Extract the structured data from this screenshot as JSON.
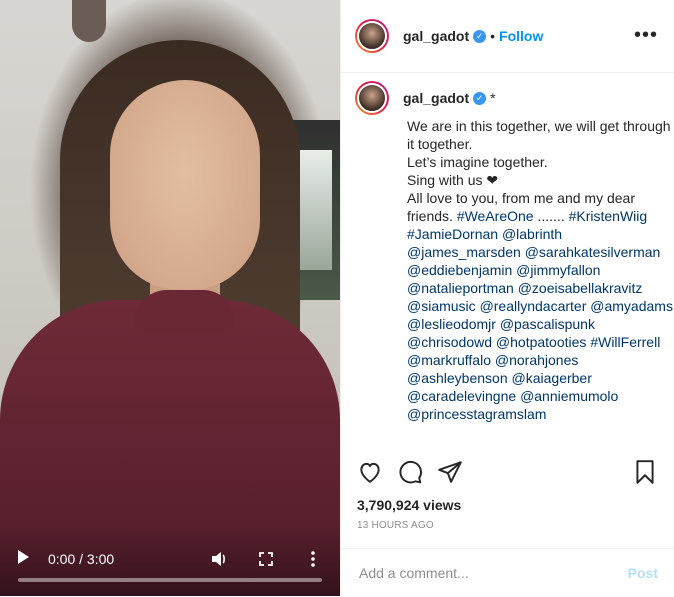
{
  "video": {
    "time_display": "0:00 / 3:00",
    "progress": 0.0,
    "controls": [
      "play-icon",
      "volume-icon",
      "fullscreen-icon",
      "more-vertical-icon"
    ]
  },
  "header": {
    "username": "gal_gadot",
    "separator": "•",
    "follow_label": "Follow",
    "more_label": "•••"
  },
  "caption": {
    "username": "gal_gadot",
    "star": "*",
    "text_parts": [
      {
        "t": "We are in this together, we will get through it together.\nLet’s imagine together.\nSing with us ❤\nAll love to you, from me and my dear friends. "
      },
      {
        "t": "#WeAreOne",
        "tag": true
      },
      {
        "t": " ....... "
      },
      {
        "t": "#KristenWiig",
        "tag": true
      },
      {
        "t": " "
      },
      {
        "t": "#JamieDornan",
        "tag": true
      },
      {
        "t": " "
      },
      {
        "t": "@labrinth",
        "tag": true
      },
      {
        "t": " "
      },
      {
        "t": "@james_marsden",
        "tag": true
      },
      {
        "t": " "
      },
      {
        "t": "@sarahkatesilverman",
        "tag": true
      },
      {
        "t": " "
      },
      {
        "t": "@eddiebenjamin",
        "tag": true
      },
      {
        "t": " "
      },
      {
        "t": "@jimmyfallon",
        "tag": true
      },
      {
        "t": " "
      },
      {
        "t": "@natalieportman",
        "tag": true
      },
      {
        "t": " "
      },
      {
        "t": "@zoeisabellakravitz",
        "tag": true
      },
      {
        "t": " "
      },
      {
        "t": "@siamusic",
        "tag": true
      },
      {
        "t": " "
      },
      {
        "t": "@reallyndacarter",
        "tag": true
      },
      {
        "t": " "
      },
      {
        "t": "@amyadams",
        "tag": true
      },
      {
        "t": " "
      },
      {
        "t": "@leslieodomjr",
        "tag": true
      },
      {
        "t": " "
      },
      {
        "t": "@pascalispunk",
        "tag": true
      },
      {
        "t": " "
      },
      {
        "t": "@chrisodowd",
        "tag": true
      },
      {
        "t": " "
      },
      {
        "t": "@hotpatooties",
        "tag": true
      },
      {
        "t": " "
      },
      {
        "t": "#WillFerrell",
        "tag": true
      },
      {
        "t": " "
      },
      {
        "t": "@markruffalo",
        "tag": true
      },
      {
        "t": " "
      },
      {
        "t": "@norahjones",
        "tag": true
      },
      {
        "t": " "
      },
      {
        "t": "@ashleybenson",
        "tag": true
      },
      {
        "t": " "
      },
      {
        "t": "@kaiagerber",
        "tag": true
      },
      {
        "t": " "
      },
      {
        "t": "@caradelevingne",
        "tag": true
      },
      {
        "t": " "
      },
      {
        "t": "@anniemumolo",
        "tag": true
      },
      {
        "t": " "
      },
      {
        "t": "@princesstagramslam",
        "tag": true
      }
    ]
  },
  "stats": {
    "views": "3,790,924 views",
    "time_ago": "13 HOURS AGO"
  },
  "comment": {
    "placeholder": "Add a comment...",
    "post_label": "Post"
  },
  "colors": {
    "link": "#00376b",
    "follow": "#0095f6",
    "post_disabled": "#b2dffc",
    "verified": "#3897f0"
  }
}
